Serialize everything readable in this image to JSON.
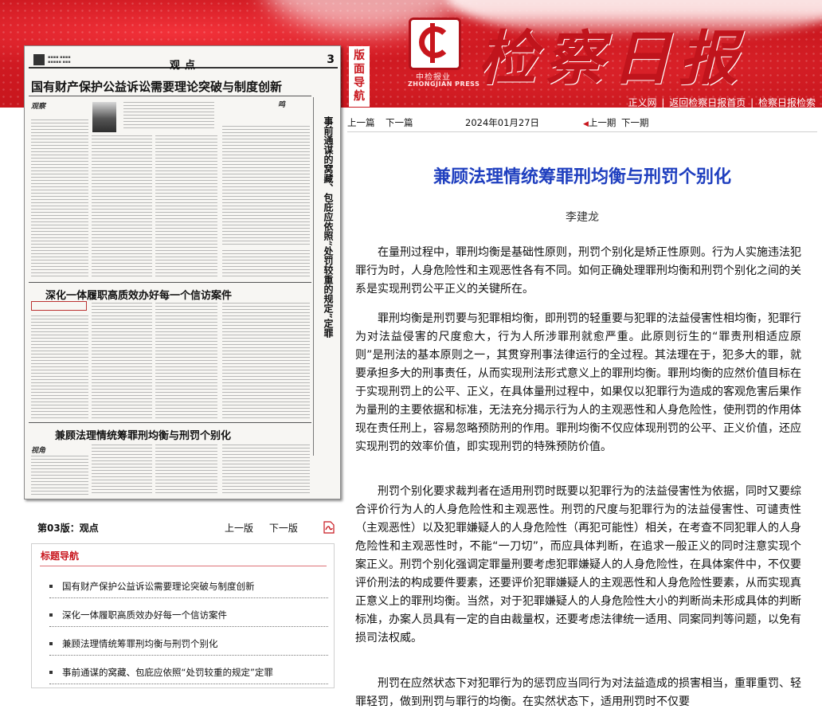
{
  "header": {
    "masthead": "检察日报",
    "logo_cn": "中检报业",
    "logo_en": "ZHONGJIAN PRESS",
    "banmian_nav": "版面导航",
    "links": [
      "正义网",
      "返回检察日报首页",
      "检察日报检索"
    ],
    "colors": {
      "brand_red": "#c8161d",
      "title_blue": "#1f3fbf"
    }
  },
  "paper_preview": {
    "section": "观点",
    "page_number": "3",
    "headline_1": "国有财产保护公益诉讼需要理论突破与制度创新",
    "headline_2": "深化一体履职高质效办好每一个信访案件",
    "headline_3": "兼顾法理情统筹罪刑均衡与刑罚个别化",
    "vertical_headline": "事前通谋的窝藏、包庇应依照“处罚较重的规定”定罪",
    "badge_1": "观察",
    "badge_2": "鸣",
    "badge_3": "视角"
  },
  "page_bar": {
    "page_label": "第03版：观点",
    "prev_page": "上一版",
    "next_page": "下一版",
    "pdf_icon": "pdf-icon"
  },
  "navbox": {
    "title": "标题导航",
    "items": [
      "国有财产保护公益诉讼需要理论突破与制度创新",
      "深化一体履职高质效办好每一个信访案件",
      "兼顾法理情统筹罪刑均衡与刑罚个别化",
      "事前通谋的窝藏、包庇应依照“处罚较重的规定”定罪"
    ]
  },
  "article_nav": {
    "prev_article": "上一篇",
    "next_article": "下一篇",
    "date": "2024年01月27日",
    "prev_issue": "上一期",
    "next_issue": "下一期"
  },
  "article": {
    "title": "兼顾法理情统筹罪刑均衡与刑罚个别化",
    "author": "李建龙",
    "paragraphs": [
      "在量刑过程中，罪刑均衡是基础性原则，刑罚个别化是矫正性原则。行为人实施违法犯罪行为时，人身危险性和主观恶性各有不同。如何正确处理罪刑均衡和刑罚个别化之间的关系是实现刑罚公平正义的关键所在。",
      "罪刑均衡是刑罚要与犯罪相均衡，即刑罚的轻重要与犯罪的法益侵害性相均衡，犯罪行为对法益侵害的尺度愈大，行为人所涉罪刑就愈严重。此原则衍生的“罪责刑相适应原则”是刑法的基本原则之一，其贯穿刑事法律运行的全过程。其法理在于，犯多大的罪，就要承担多大的刑事责任，从而实现刑法形式意义上的罪刑均衡。罪刑均衡的应然价值目标在于实现刑罚上的公平、正义，在具体量刑过程中，如果仅以犯罪行为造成的客观危害后果作为量刑的主要依据和标准，无法充分揭示行为人的主观恶性和人身危险性，使刑罚的作用体现在责任刑上，容易忽略预防刑的作用。罪刑均衡不仅应体现刑罚的公平、正义价值，还应实现刑罚的效率价值，即实现刑罚的特殊预防价值。",
      "刑罚个别化要求裁判者在适用刑罚时既要以犯罪行为的法益侵害性为依据，同时又要综合评价行为人的人身危险性和主观恶性。刑罚的尺度与犯罪行为的法益侵害性、可谴责性（主观恶性）以及犯罪嫌疑人的人身危险性（再犯可能性）相关，在考查不同犯罪人的人身危险性和主观恶性时，不能“一刀切”，而应具体判断，在追求一般正义的同时注意实现个案正义。刑罚个别化强调定罪量刑要考虑犯罪嫌疑人的人身危险性，在具体案件中，不仅要评价刑法的构成要件要素，还要评价犯罪嫌疑人的主观恶性和人身危险性要素，从而实现真正意义上的罪刑均衡。当然，对于犯罪嫌疑人的人身危险性大小的判断尚未形成具体的判断标准，办案人员具有一定的自由裁量权，还要考虑法律统一适用、同案同判等问题，以免有损司法权威。",
      "刑罚在应然状态下对犯罪行为的惩罚应当同行为对法益造成的损害相当，重罪重罚、轻罪轻罚，做到刑罚与罪行的均衡。在实然状态下，适用刑罚时不仅要"
    ]
  }
}
